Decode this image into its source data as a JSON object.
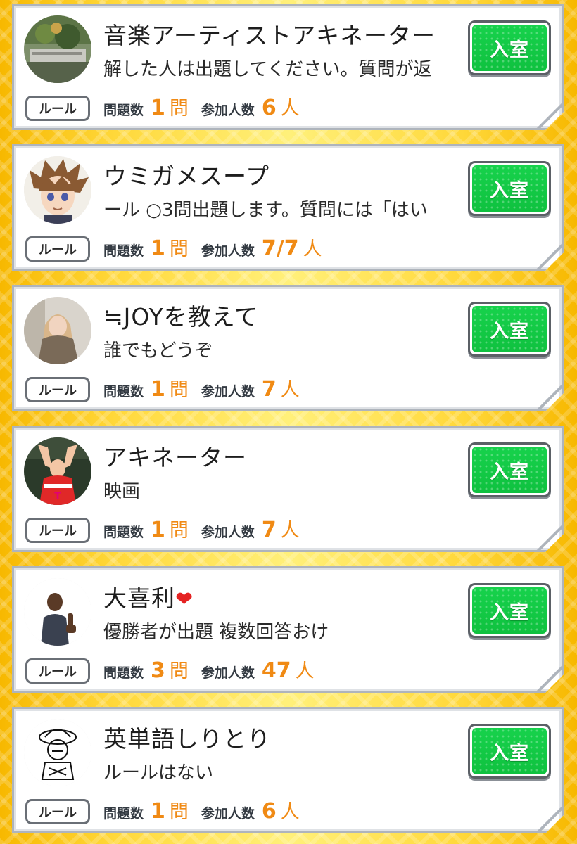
{
  "rooms": [
    {
      "title": "音楽アーティストアキネーター",
      "description": "解した人は出題してください。質問が返",
      "avatar": "landscape-avatar",
      "enter_label": "入室",
      "rule_label": "ルール",
      "questions_label": "問題数",
      "questions_count": "1",
      "questions_unit": "問",
      "participants_label": "参加人数",
      "participants_count": "6",
      "participants_unit": "人"
    },
    {
      "title": "ウミガメスープ",
      "description": "ール ○3問出題します。質問には「はい",
      "avatar": "anime-boy-avatar",
      "enter_label": "入室",
      "rule_label": "ルール",
      "questions_label": "問題数",
      "questions_count": "1",
      "questions_unit": "問",
      "participants_label": "参加人数",
      "participants_count": "7/7",
      "participants_unit": "人"
    },
    {
      "title": "≒JOYを教えて",
      "description": "誰でもどうぞ",
      "avatar": "girl-photo-avatar",
      "enter_label": "入室",
      "rule_label": "ルール",
      "questions_label": "問題数",
      "questions_count": "1",
      "questions_unit": "問",
      "participants_label": "参加人数",
      "participants_count": "7",
      "participants_unit": "人"
    },
    {
      "title": "アキネーター",
      "description": "映画",
      "avatar": "football-player-avatar",
      "enter_label": "入室",
      "rule_label": "ルール",
      "questions_label": "問題数",
      "questions_count": "1",
      "questions_unit": "問",
      "participants_label": "参加人数",
      "participants_count": "7",
      "participants_unit": "人"
    },
    {
      "title": "大喜利",
      "title_emoji": "❤",
      "description": "優勝者が出題 複数回答おけ",
      "avatar": "thumbs-up-man-avatar",
      "enter_label": "入室",
      "rule_label": "ルール",
      "questions_label": "問題数",
      "questions_count": "3",
      "questions_unit": "問",
      "participants_label": "参加人数",
      "participants_count": "47",
      "participants_unit": "人"
    },
    {
      "title": "英単語しりとり",
      "description": "ルールはない",
      "avatar": "sketch-pirate-avatar",
      "enter_label": "入室",
      "rule_label": "ルール",
      "questions_label": "問題数",
      "questions_count": "1",
      "questions_unit": "問",
      "participants_label": "参加人数",
      "participants_count": "6",
      "participants_unit": "人"
    }
  ],
  "colors": {
    "enter_green": "#12c944",
    "count_orange": "#f08a14",
    "card_border": "#aeb4bc",
    "background_gold": "#ffd83a"
  }
}
